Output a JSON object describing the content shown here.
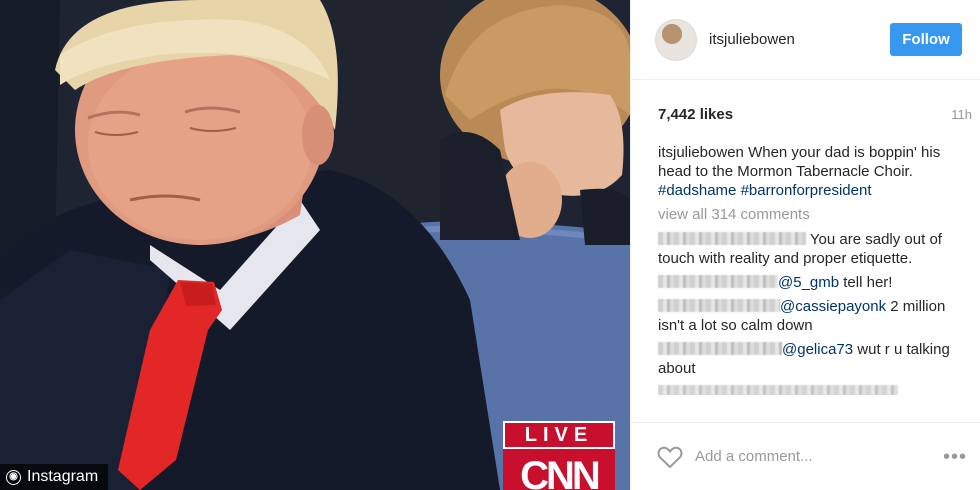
{
  "photo": {
    "live_label": "LIVE",
    "network_logo": "CNN",
    "watermark_label": "Instagram",
    "watermark_icon": "instagram-icon"
  },
  "header": {
    "username": "itsjuliebowen",
    "follow_label": "Follow",
    "avatar_icon": "avatar"
  },
  "meta": {
    "likes": "7,442 likes",
    "time_ago": "11h"
  },
  "caption": {
    "username": "itsjuliebowen",
    "text": "When your dad is boppin' his head to the Mormon Tabernacle Choir.",
    "hashtag_1": "#dadshame",
    "hashtag_2": "#barronforpresident"
  },
  "view_all_comments": "view all 314 comments",
  "comments": [
    {
      "mention": "",
      "text": "You are sadly out of touch with reality and proper etiquette."
    },
    {
      "mention": "@5_gmb",
      "text": "tell her!"
    },
    {
      "mention": "@cassiepayonk",
      "text": "2 million isn't a lot so calm down"
    },
    {
      "mention": "@gelica73",
      "text": "wut r u talking about"
    }
  ],
  "footer": {
    "comment_placeholder": "Add a comment...",
    "more_glyph": "•••"
  },
  "colors": {
    "follow_button": "#3897f0",
    "link": "#003569",
    "muted": "#999999",
    "cnn_red": "#c8102e"
  }
}
